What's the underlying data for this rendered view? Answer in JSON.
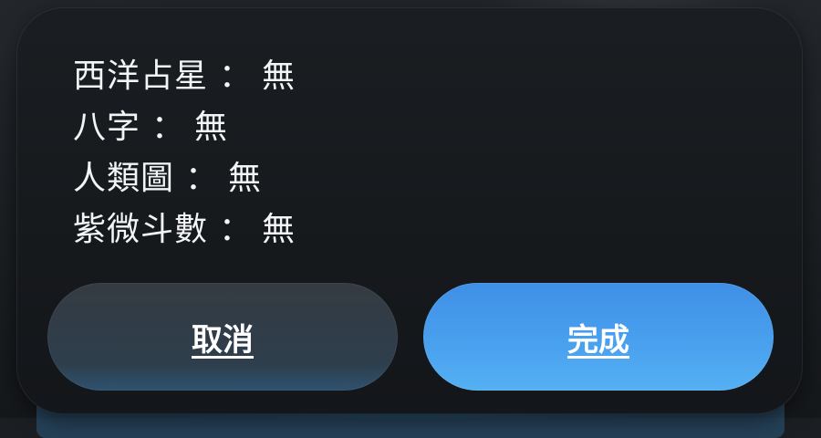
{
  "dialog": {
    "items": [
      {
        "label": "西洋占星",
        "separator": "：",
        "value": "無"
      },
      {
        "label": "八字",
        "separator": "：",
        "value": "無"
      },
      {
        "label": "人類圖",
        "separator": "：",
        "value": "無"
      },
      {
        "label": "紫微斗數",
        "separator": "：",
        "value": "無"
      }
    ],
    "cancel_label": "取消",
    "done_label": "完成"
  },
  "colors": {
    "dialog_background": "#16191c",
    "text": "#f2f4f6",
    "cancel_button": "#353b42",
    "done_button": "#4aa2ef"
  }
}
